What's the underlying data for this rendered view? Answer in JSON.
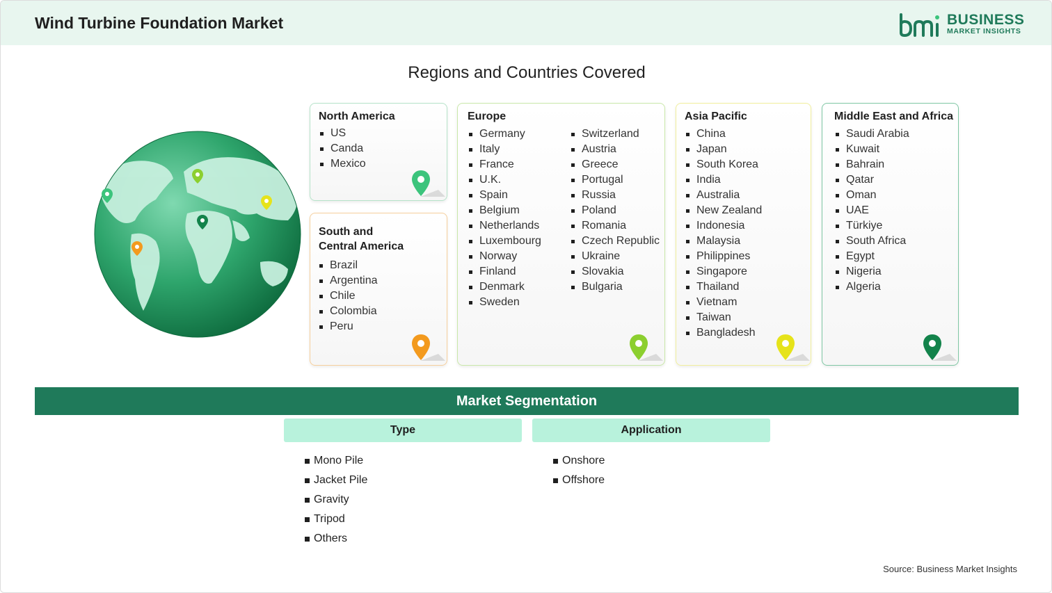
{
  "header": {
    "title": "Wind Turbine Foundation Market",
    "logo_main": "BUSINESS",
    "logo_sub": "MARKET INSIGHTS"
  },
  "regions_title": "Regions and Countries Covered",
  "regions": {
    "north_america": {
      "title": "North America",
      "color": "#b6e3c9",
      "pin_color": "#3cc47c",
      "items": [
        "US",
        "Canda",
        "Mexico"
      ]
    },
    "south_america": {
      "title_line1": "South and",
      "title_line2": "Central America",
      "color": "#f6cf9c",
      "pin_color": "#f39a1e",
      "items": [
        "Brazil",
        "Argentina",
        "Chile",
        "Colombia",
        "Peru"
      ]
    },
    "europe": {
      "title": "Europe",
      "color": "#c9e8a9",
      "pin_color": "#8ccf2f",
      "items_col1": [
        "Germany",
        "Italy",
        "France",
        "U.K.",
        "Spain",
        "Belgium",
        "Netherlands",
        "Luxembourg",
        "Norway",
        "Finland",
        "Denmark",
        "Sweden"
      ],
      "items_col2": [
        "Switzerland",
        "Austria",
        "Greece",
        "Portugal",
        "Russia",
        "Poland",
        "Romania",
        "Czech Republic",
        "Ukraine",
        "Slovakia",
        "Bulgaria"
      ]
    },
    "asia_pacific": {
      "title": "Asia Pacific",
      "color": "#f1ef9c",
      "pin_color": "#e6e31a",
      "items": [
        "China",
        "Japan",
        "South Korea",
        "India",
        "Australia",
        "New Zealand",
        "Indonesia",
        "Malaysia",
        "Philippines",
        "Singapore",
        "Thailand",
        "Vietnam",
        "Taiwan",
        "Bangladesh"
      ]
    },
    "mea": {
      "title": "Middle East and Africa",
      "color": "#7fc7a4",
      "pin_color": "#13834b",
      "items": [
        "Saudi Arabia",
        "Kuwait",
        "Bahrain",
        "Qatar",
        "Oman",
        "UAE",
        "Türkiye",
        "South Africa",
        "Egypt",
        "Nigeria",
        "Algeria"
      ]
    }
  },
  "segmentation": {
    "title": "Market Segmentation",
    "type": {
      "label": "Type",
      "items": [
        "Mono Pile",
        "Jacket Pile",
        "Gravity",
        "Tripod",
        "Others"
      ]
    },
    "application": {
      "label": "Application",
      "items": [
        "Onshore",
        "Offshore"
      ]
    }
  },
  "source": "Source: Business Market Insights",
  "colors": {
    "brand": "#1f7a5a",
    "header_bg": "#e8f6ef",
    "segment_head_bg": "#b8f2dc"
  }
}
